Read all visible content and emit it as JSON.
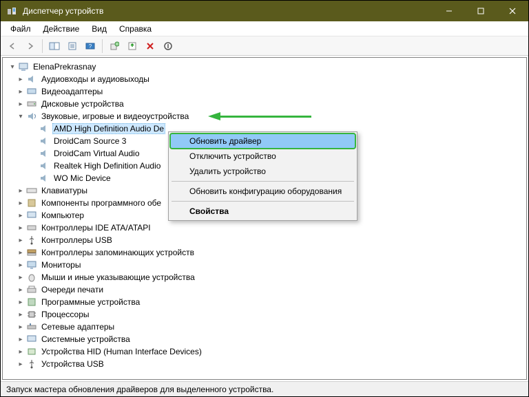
{
  "window": {
    "title": "Диспетчер устройств"
  },
  "menu": {
    "file": "Файл",
    "action": "Действие",
    "view": "Вид",
    "help": "Справка"
  },
  "tree": {
    "root": "ElenaPrekrasnay",
    "cat": {
      "audio_io": "Аудиовходы и аудиовыходы",
      "video_adapters": "Видеоадаптеры",
      "disk_drives": "Дисковые устройства",
      "sound_game_video": "Звуковые, игровые и видеоустройства",
      "keyboards": "Клавиатуры",
      "software_components": "Компоненты программного обе",
      "computer": "Компьютер",
      "ide_atapi": "Контроллеры IDE ATA/ATAPI",
      "usb_controllers": "Контроллеры USB",
      "storage_controllers": "Контроллеры запоминающих устройств",
      "monitors": "Мониторы",
      "mice": "Мыши и иные указывающие устройства",
      "print_queues": "Очереди печати",
      "software_devices": "Программные устройства",
      "processors": "Процессоры",
      "network_adapters": "Сетевые адаптеры",
      "system_devices": "Системные устройства",
      "hid": "Устройства HID (Human Interface Devices)",
      "usb_devices": "Устройства USB"
    },
    "sound_children": {
      "amd_hd_audio": "AMD High Definition Audio De",
      "droidcam_src3": "DroidCam Source 3",
      "droidcam_virtual": "DroidCam Virtual Audio",
      "realtek_hd_audio": "Realtek High Definition Audio",
      "wo_mic": "WO Mic Device"
    }
  },
  "ctx": {
    "update_driver": "Обновить драйвер",
    "disable_device": "Отключить устройство",
    "uninstall_device": "Удалить устройство",
    "scan_hw": "Обновить конфигурацию оборудования",
    "properties": "Свойства"
  },
  "status": {
    "text": "Запуск мастера обновления драйверов для выделенного устройства."
  }
}
